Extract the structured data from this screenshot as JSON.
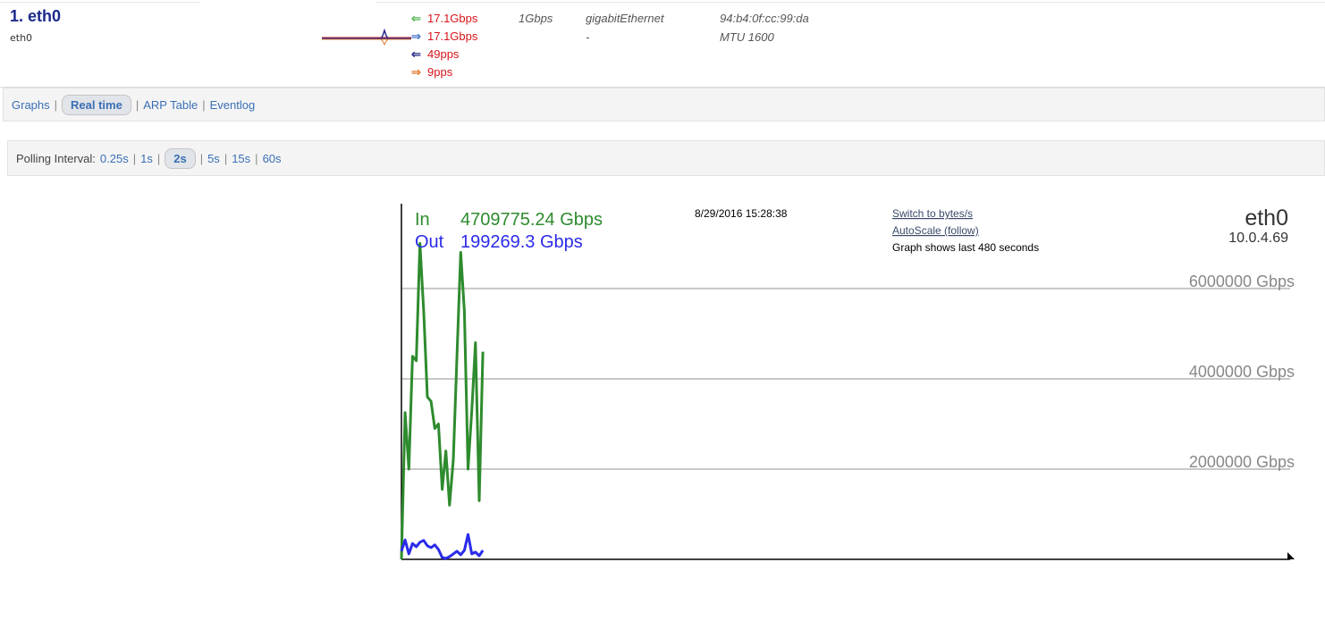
{
  "interface": {
    "title": "1. eth0",
    "subtitle": "eth0",
    "in_rate": "17.1Gbps",
    "out_rate": "17.1Gbps",
    "in_pps": "49pps",
    "out_pps": "9pps",
    "speed": "1Gbps",
    "type": "gigabitEthernet",
    "mac": "94:b4:0f:cc:99:da",
    "dash": "-",
    "mtu": "MTU 1600"
  },
  "nav": {
    "items": [
      "Graphs",
      "Real time",
      "ARP Table",
      "Eventlog"
    ],
    "active": "Real time"
  },
  "polling": {
    "label": "Polling Interval:",
    "options": [
      "0.25s",
      "1s",
      "2s",
      "5s",
      "15s",
      "60s"
    ],
    "active": "2s"
  },
  "graph": {
    "in_label": "In",
    "in_value": "4709775.24 Gbps",
    "out_label": "Out",
    "out_value": "199269.3 Gbps",
    "timestamp": "8/29/2016 15:28:38",
    "switch_link": "Switch to bytes/s",
    "autoscale_link": "AutoScale (follow)",
    "duration_note": "Graph shows last 480 seconds",
    "iface_name": "eth0",
    "iface_ip": "10.0.4.69",
    "colors": {
      "in": "#2e8b2e",
      "out": "#2b2bea",
      "grid": "#c8c8c8",
      "grid_label": "#888888"
    }
  },
  "chart_data": {
    "type": "line",
    "x_unit": "seconds",
    "x_range": [
      0,
      480
    ],
    "ylim": [
      0,
      7800000
    ],
    "y_ticks": [
      {
        "value": 2000000,
        "label": "2000000 Gbps"
      },
      {
        "value": 4000000,
        "label": "4000000 Gbps"
      },
      {
        "value": 6000000,
        "label": "6000000 Gbps"
      }
    ],
    "series": [
      {
        "name": "In",
        "x": [
          0,
          2,
          4,
          6,
          8,
          10,
          12,
          14,
          16,
          18,
          20,
          22,
          24,
          26,
          28,
          30,
          32,
          34,
          36,
          38,
          40,
          42,
          44
        ],
        "values": [
          0,
          3250000,
          2000000,
          4500000,
          4400000,
          7000000,
          5500000,
          3600000,
          3500000,
          2900000,
          3000000,
          1550000,
          2400000,
          1200000,
          2200000,
          4500000,
          6800000,
          5500000,
          2000000,
          3300000,
          4800000,
          1300000,
          4600000
        ]
      },
      {
        "name": "Out",
        "x": [
          0,
          2,
          4,
          6,
          8,
          10,
          12,
          14,
          16,
          18,
          20,
          22,
          24,
          26,
          28,
          30,
          32,
          34,
          36,
          38,
          40,
          42,
          44
        ],
        "values": [
          180000,
          430000,
          120000,
          350000,
          280000,
          380000,
          420000,
          300000,
          260000,
          320000,
          220000,
          40000,
          20000,
          60000,
          120000,
          180000,
          100000,
          200000,
          550000,
          120000,
          160000,
          80000,
          200000
        ]
      }
    ]
  }
}
